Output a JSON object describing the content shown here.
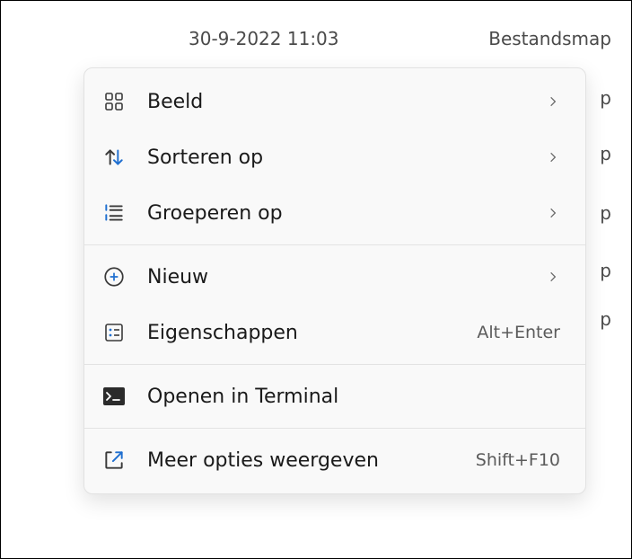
{
  "background": {
    "date": "30-9-2022 11:03",
    "type": "Bestandsmap",
    "p_rows": [
      "p",
      "p",
      "p",
      "p",
      "p"
    ]
  },
  "menu": {
    "items": [
      {
        "label": "Beeld",
        "has_sub": true
      },
      {
        "label": "Sorteren op",
        "has_sub": true
      },
      {
        "label": "Groeperen op",
        "has_sub": true
      },
      {
        "label": "Nieuw",
        "has_sub": true
      },
      {
        "label": "Eigenschappen",
        "shortcut": "Alt+Enter"
      },
      {
        "label": "Openen in Terminal"
      },
      {
        "label": "Meer opties weergeven",
        "shortcut": "Shift+F10"
      }
    ]
  }
}
